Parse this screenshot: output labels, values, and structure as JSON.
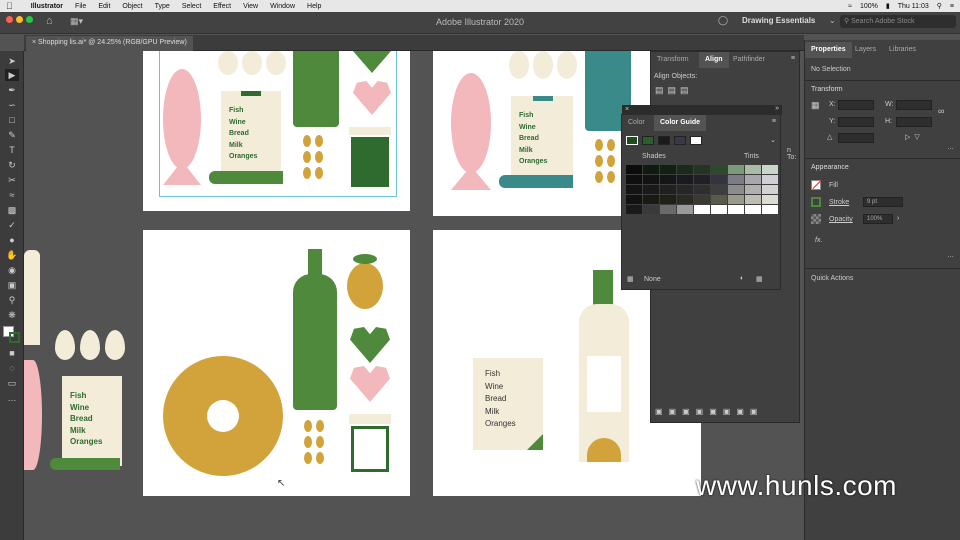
{
  "menubar": {
    "app": "Illustrator",
    "items": [
      "File",
      "Edit",
      "Object",
      "Type",
      "Select",
      "Effect",
      "View",
      "Window",
      "Help"
    ],
    "battery": "100%",
    "clock": "Thu 11:03"
  },
  "app": {
    "title": "Adobe Illustrator 2020",
    "workspace": "Drawing Essentials",
    "search_placeholder": "Search Adobe Stock"
  },
  "document": {
    "tab_label": "Shopping lis.ai* @ 24.25% (RGB/GPU Preview)"
  },
  "shopping_list": [
    "Fish",
    "Wine",
    "Bread",
    "Milk",
    "Oranges"
  ],
  "align_panel": {
    "tabs": [
      "Transform",
      "Align",
      "Pathfinder"
    ],
    "active_tab": "Align",
    "section": "Align Objects:",
    "align_to_label": "n To:"
  },
  "color_panel": {
    "tabs": [
      "Color",
      "Color Guide"
    ],
    "active_tab": "Color Guide",
    "shades_label": "Shades",
    "tints_label": "Tints",
    "none_label": "None",
    "base_colors": [
      "#1e4d1e",
      "#2b5e2b",
      "#1a1a1a",
      "#3a3a46",
      "#ffffff"
    ],
    "grid_colors": [
      [
        "#0c0c0c",
        "#101a10",
        "#122012",
        "#1c2a1c",
        "#243524",
        "#2e4a2e",
        "#7a9a7a",
        "#a8bca8",
        "#cad6ca"
      ],
      [
        "#0f0f0f",
        "#131313",
        "#161616",
        "#1a1a1f",
        "#202026",
        "#34343f",
        "#7c7c86",
        "#a7a7ae",
        "#cfcfd4"
      ],
      [
        "#141414",
        "#1a1a1a",
        "#202020",
        "#262626",
        "#2e2e2e",
        "#3e3e3e",
        "#8c8c8c",
        "#b0b0b0",
        "#d2d2d2"
      ],
      [
        "#121212",
        "#1a1a14",
        "#20201a",
        "#2a2a22",
        "#3a3a30",
        "#5a5a4a",
        "#9a9a8a",
        "#bdbdb2",
        "#dcdcd4"
      ],
      [
        "#1a1a1a",
        "#3a3a3a",
        "#6a6a6a",
        "#9a9a9a",
        "#ffffff",
        "#ffffff",
        "#ffffff",
        "#ffffff",
        "#ffffff"
      ]
    ]
  },
  "properties": {
    "tabs": [
      "Properties",
      "Layers",
      "Libraries"
    ],
    "active_tab": "Properties",
    "selection": "No Selection",
    "transform_label": "Transform",
    "x_label": "X:",
    "y_label": "Y:",
    "w_label": "W:",
    "h_label": "H:",
    "appearance_label": "Appearance",
    "fill_label": "Fill",
    "stroke_label": "Stroke",
    "stroke_value": "9 pt",
    "opacity_label": "Opacity",
    "opacity_value": "100%",
    "fx_label": "fx.",
    "quick_actions_label": "Quick Actions"
  },
  "colors": {
    "green_dark": "#2f6b2f",
    "green_mid": "#4f8a3c",
    "pink": "#f2b8bc",
    "mustard": "#d2a23b",
    "cream": "#f3ecd8",
    "teal": "#3a8a8a"
  },
  "watermark": "www.hunls.com"
}
